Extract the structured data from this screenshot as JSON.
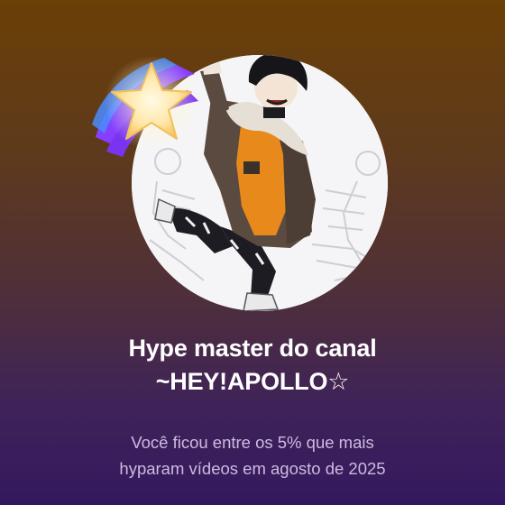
{
  "card": {
    "title_line1": "Hype master do canal",
    "title_line2": "~HEY!APOLLO☆",
    "subtitle_line1": "Você ficou entre os 5% que mais",
    "subtitle_line2": "hyparam vídeos em agosto de 2025"
  },
  "icons": {
    "badge": "hype-star-badge-icon",
    "avatar": "channel-avatar"
  },
  "colors": {
    "gradient_top": "#6b3f06",
    "gradient_bottom": "#34185f",
    "title": "#ffffff",
    "subtitle": "#cdbbe0"
  }
}
